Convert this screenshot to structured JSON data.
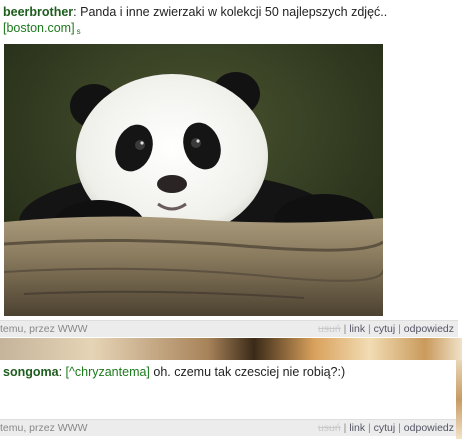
{
  "post1": {
    "user": "beerbrother",
    "separator": ":",
    "text": "Panda i inne zwierzaki w kolekcji 50 najlepszych zdjęć..",
    "source": "[boston.com]",
    "source_sup": "s",
    "image_alt": "baby panda resting on a log",
    "footer": {
      "when": "temu, przez WWW",
      "delete": "usuń",
      "link": "link",
      "quote": "cytuj",
      "reply": "odpowiedz",
      "sep": " | "
    }
  },
  "post2": {
    "user": "songoma",
    "separator": ":",
    "mention": "[^chryzantema]",
    "text": " oh. czemu tak czesciej nie robią?:)",
    "footer": {
      "when": "temu, przez WWW",
      "delete": "usuń",
      "link": "link",
      "quote": "cytuj",
      "reply": "odpowiedz",
      "sep": " | "
    }
  },
  "colors": {
    "username": "#1d5d1d",
    "source_link": "#1d7a1d",
    "footer_bg": "#ececec"
  }
}
